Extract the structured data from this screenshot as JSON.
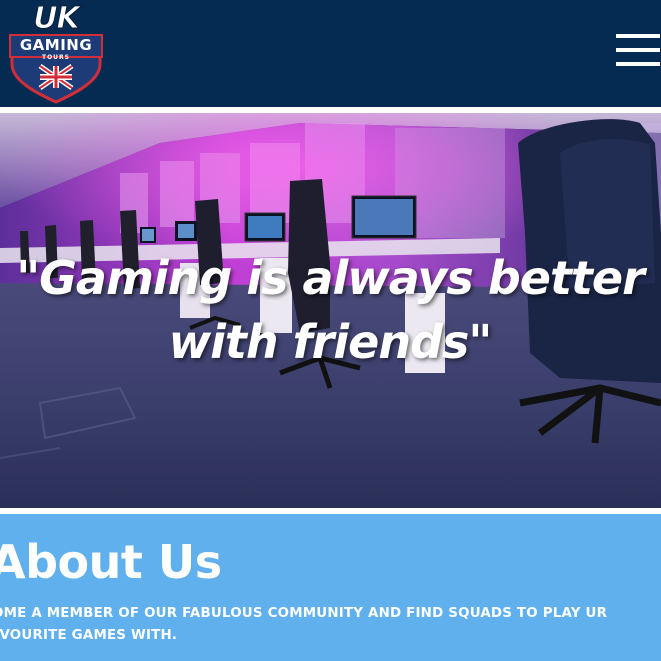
{
  "header": {
    "logo": {
      "line1": "UK",
      "line2": "GAMING",
      "line3": "TOURS",
      "icon": "union-jack-shield-icon"
    },
    "menu_icon": "hamburger-menu-icon"
  },
  "hero": {
    "quote": "\"Gaming is always better\nwith friends\""
  },
  "about": {
    "title": "About Us",
    "text": "COME A MEMBER OF OUR FABULOUS COMMUNITY AND FIND SQUADS TO PLAY UR FAVOURITE GAMES WITH."
  },
  "colors": {
    "header_bg": "#062b52",
    "about_bg": "#5fb0ec",
    "text": "#ffffff"
  }
}
